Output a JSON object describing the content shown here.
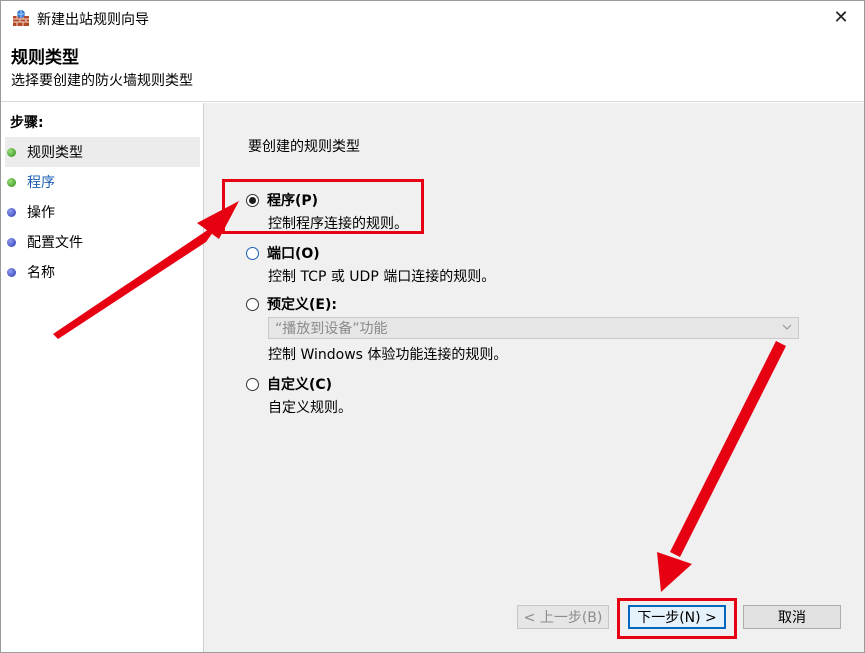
{
  "window": {
    "title": "新建出站规则向导",
    "close_glyph": "✕"
  },
  "header": {
    "heading": "规则类型",
    "subheading": "选择要创建的防火墙规则类型"
  },
  "steps": {
    "header": "步骤:",
    "items": [
      {
        "label": "规则类型",
        "status": "completed",
        "color": "#2c8a1a"
      },
      {
        "label": "程序",
        "status": "current",
        "color": "#2c8a1a"
      },
      {
        "label": "操作",
        "status": "pending",
        "color": "#2a38b0"
      },
      {
        "label": "配置文件",
        "status": "pending",
        "color": "#2a38b0"
      },
      {
        "label": "名称",
        "status": "pending",
        "color": "#2a38b0"
      }
    ]
  },
  "content": {
    "question": "要创建的规则类型",
    "options": [
      {
        "label": "程序(P)",
        "description": "控制程序连接的规则。",
        "checked": true
      },
      {
        "label": "端口(O)",
        "description": "控制 TCP 或 UDP 端口连接的规则。",
        "checked": false
      },
      {
        "label": "预定义(E):",
        "description": "控制 Windows 体验功能连接的规则。",
        "checked": false
      },
      {
        "label": "自定义(C)",
        "description": "自定义规则。",
        "checked": false
      }
    ],
    "predefined_select": {
      "value": "“播放到设备”功能",
      "disabled": true
    }
  },
  "buttons": {
    "back": "< 上一步(B)",
    "next": "下一步(N) >",
    "cancel": "取消"
  },
  "colors": {
    "accent": "#0067c0",
    "highlight": "#e60012",
    "content_bg": "#f0f0f0"
  }
}
